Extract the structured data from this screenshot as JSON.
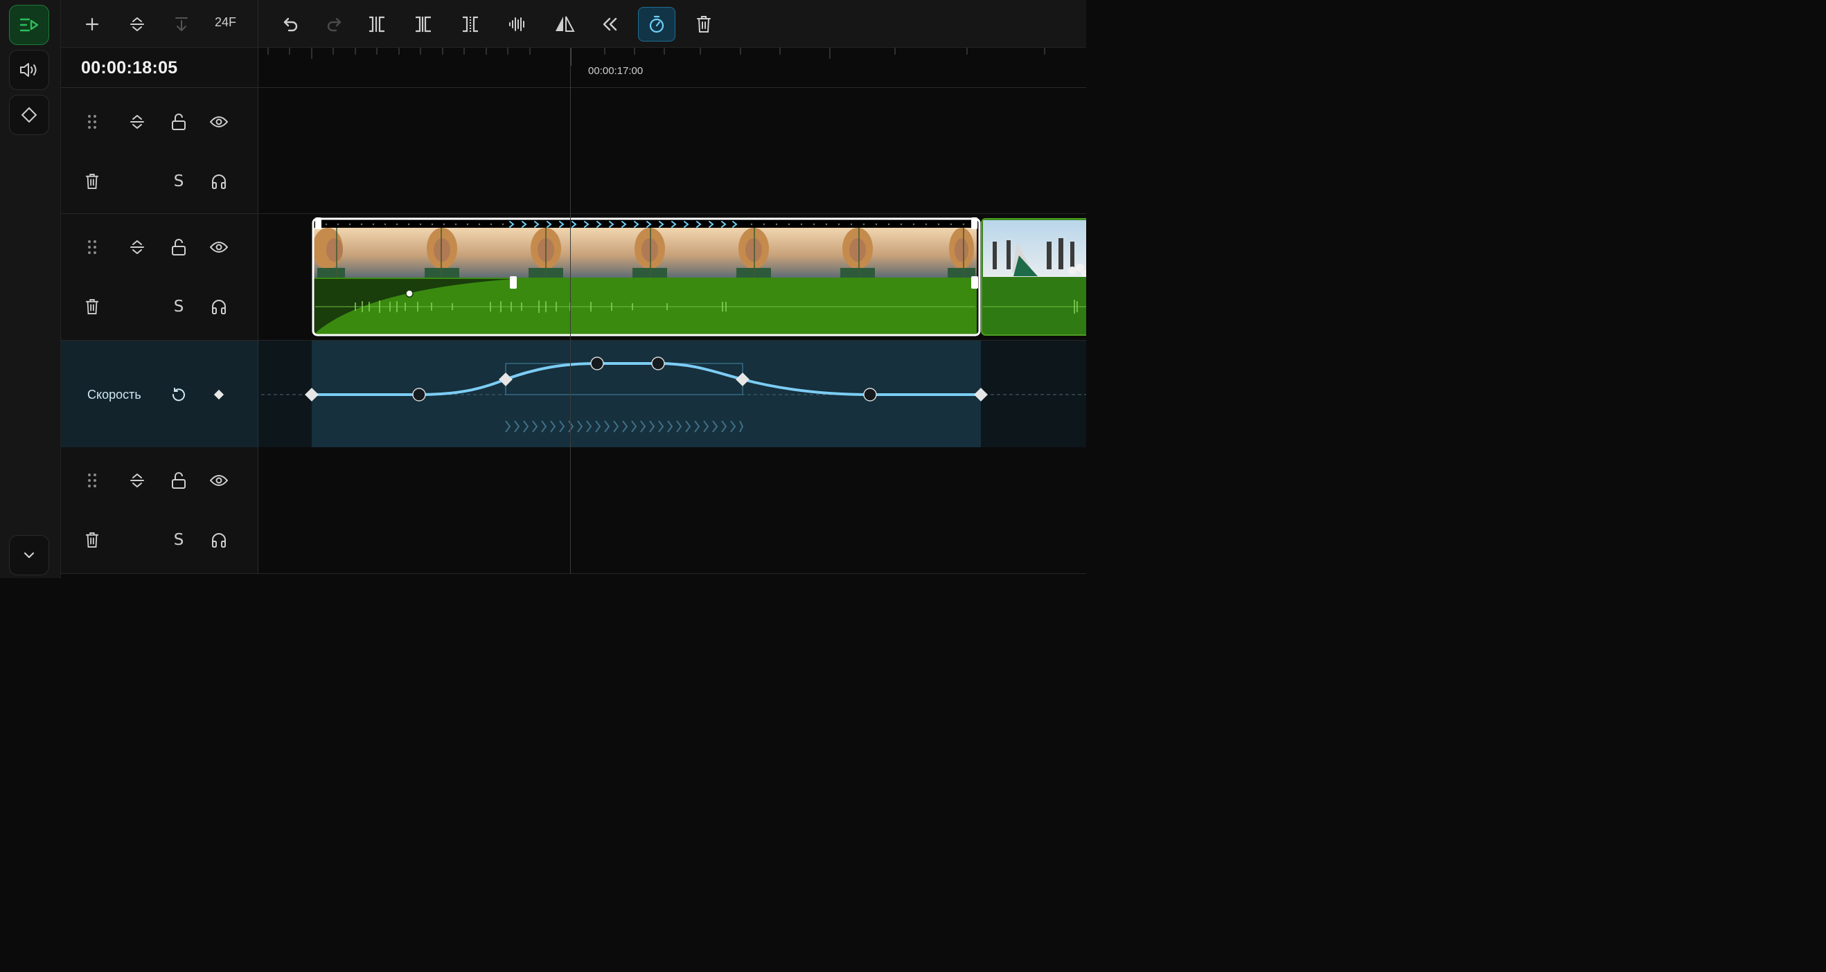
{
  "header": {
    "fps_label": "24F",
    "timecode": "00:00:18:05",
    "ruler_time": "00:00:17:00"
  },
  "speed_track": {
    "label": "Скорость"
  },
  "tracks": [
    {
      "id": "track-1",
      "solo_label": "S"
    },
    {
      "id": "track-2",
      "solo_label": "S"
    },
    {
      "id": "track-3",
      "solo_label": "S"
    }
  ],
  "colors": {
    "accent_green": "#2dbd5a",
    "audio_green": "#3a8a10",
    "speed_curve": "#7ccdf4",
    "active_blue": "#1f6f93"
  },
  "icons": {
    "rail": [
      "timeline-icon",
      "volume-icon",
      "keyframe-diamond-icon",
      "chevron-down-icon"
    ],
    "toolbar": [
      "add-icon",
      "expand-collapse-icon",
      "arrow-down-icon",
      "undo-icon",
      "redo-icon",
      "split-icon",
      "trim-left-icon",
      "trim-right-icon",
      "audio-waveform-icon",
      "mirror-icon",
      "rewind-icon",
      "speed-timer-icon",
      "trash-icon"
    ]
  }
}
